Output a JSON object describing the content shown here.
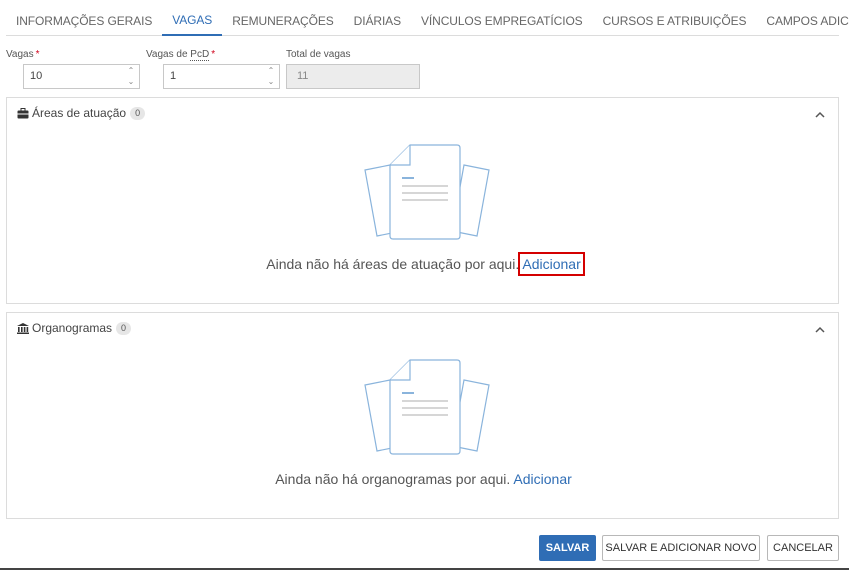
{
  "tabs": [
    {
      "label": "INFORMAÇÕES GERAIS"
    },
    {
      "label": "VAGAS"
    },
    {
      "label": "REMUNERAÇÕES"
    },
    {
      "label": "DIÁRIAS"
    },
    {
      "label": "VÍNCULOS EMPREGATÍCIOS"
    },
    {
      "label": "CURSOS E ATRIBUIÇÕES"
    },
    {
      "label": "CAMPOS ADICIONAIS"
    }
  ],
  "active_tab": "VAGAS",
  "form": {
    "vagas": {
      "label": "Vagas",
      "required": "*",
      "value": "10"
    },
    "vagas_pcd": {
      "label_prefix": "Vagas de ",
      "label_abbr": "PcD",
      "required": "*",
      "value": "1"
    },
    "total_vagas": {
      "label": "Total de vagas",
      "value": "11"
    }
  },
  "areas": {
    "title": "Áreas de atuação",
    "count": "0",
    "empty_text": "Ainda não há áreas de atuação por aqui.",
    "add_link": "Adicionar"
  },
  "organogramas": {
    "title": "Organogramas",
    "count": "0",
    "empty_text": "Ainda não há organogramas por aqui.",
    "add_link": "Adicionar"
  },
  "footer": {
    "save": "SALVAR",
    "save_add_new": "SALVAR E ADICIONAR NOVO",
    "cancel": "CANCELAR"
  },
  "colors": {
    "accent": "#2f6db5",
    "required": "#d0021b",
    "highlight": "#d40000"
  }
}
